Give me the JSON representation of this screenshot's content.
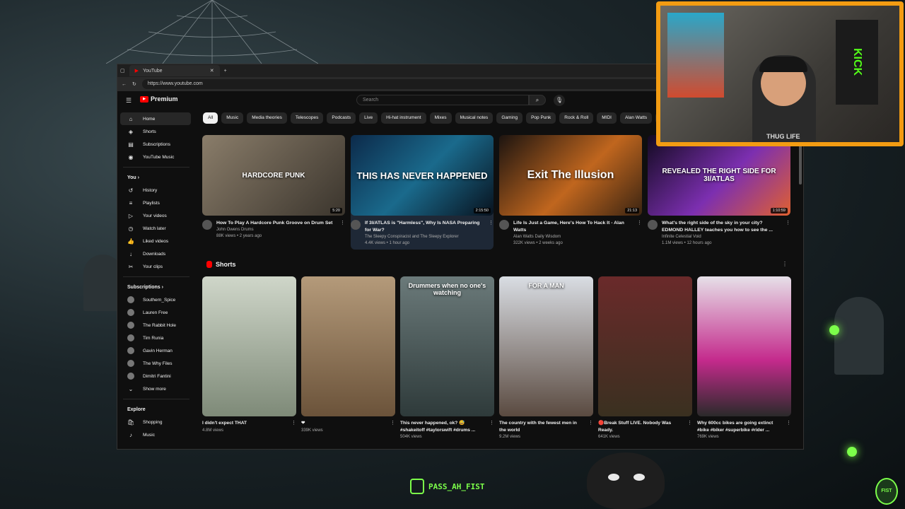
{
  "browser": {
    "tab_title": "YouTube",
    "url": "https://www.youtube.com"
  },
  "youtube": {
    "logo_text": "Premium",
    "search_placeholder": "Search",
    "chips": [
      "All",
      "Music",
      "Media theories",
      "Telescopes",
      "Podcasts",
      "Live",
      "Hi-hat instrument",
      "Mixes",
      "Musical notes",
      "Gaming",
      "Pop Punk",
      "Rock & Roll",
      "MIDI",
      "Alan Watts",
      "AI",
      "Gu"
    ],
    "sidebar": {
      "main": [
        {
          "label": "Home",
          "icon": "home-icon"
        },
        {
          "label": "Shorts",
          "icon": "shorts-icon"
        },
        {
          "label": "Subscriptions",
          "icon": "subscriptions-icon"
        },
        {
          "label": "YouTube Music",
          "icon": "music-icon"
        }
      ],
      "you_heading": "You",
      "you": [
        {
          "label": "History",
          "icon": "history-icon"
        },
        {
          "label": "Playlists",
          "icon": "playlists-icon"
        },
        {
          "label": "Your videos",
          "icon": "your-videos-icon"
        },
        {
          "label": "Watch later",
          "icon": "watch-later-icon"
        },
        {
          "label": "Liked videos",
          "icon": "like-icon"
        },
        {
          "label": "Downloads",
          "icon": "download-icon"
        },
        {
          "label": "Your clips",
          "icon": "clips-icon"
        }
      ],
      "subscriptions_heading": "Subscriptions",
      "subscriptions": [
        {
          "label": "Southern_Spice"
        },
        {
          "label": "Lauren Free"
        },
        {
          "label": "The Rabbit Hole"
        },
        {
          "label": "Tim Runia"
        },
        {
          "label": "Gavin Herman"
        },
        {
          "label": "The Why Files"
        },
        {
          "label": "Dimitri Fantini"
        }
      ],
      "show_more": "Show more",
      "explore_heading": "Explore",
      "explore": [
        {
          "label": "Shopping",
          "icon": "shopping-icon"
        },
        {
          "label": "Music",
          "icon": "music-note-icon"
        }
      ]
    },
    "videos": [
      {
        "thumb_text": "HARDCORE PUNK",
        "duration": "5:20",
        "title": "How To Play A Hardcore Punk Groove on Drum Set",
        "channel": "John Owens Drums",
        "stats": "88K views • 2 years ago"
      },
      {
        "thumb_text": "THIS HAS NEVER HAPPENED",
        "duration": "2:15:50",
        "title": "If 3I/ATLAS is \"Harmless\", Why Is NASA Preparing for War?",
        "channel": "The Sleepy Conspiracist and The Sleepy Explorer",
        "stats": "4.4K views • 1 hour ago"
      },
      {
        "thumb_text": "Exit The Illusion",
        "duration": "21:13",
        "title": "Life Is Just a Game, Here's How To Hack It - Alan Watts",
        "channel": "Alan Watts Daily Wisdom",
        "stats": "322K views • 2 weeks ago"
      },
      {
        "thumb_text": "REVEALED THE RIGHT SIDE FOR 3I/ATLAS",
        "duration": "1:10:59",
        "title": "What's the right side of the sky in your city? EDMOND HALLEY teaches you how to see the ...",
        "channel": "Infinite Celestial Void",
        "stats": "1.1M views • 12 hours ago"
      }
    ],
    "shorts_heading": "Shorts",
    "shorts": [
      {
        "thumb_text": "",
        "title": "I didn't expect THAT",
        "views": "4.8M views"
      },
      {
        "thumb_text": "",
        "title": "❤",
        "views": "339K views"
      },
      {
        "thumb_text": "Drummers when no one's watching",
        "title": "This never happened, ok? 😅 #shakeitoff #taylorswift #drums ...",
        "views": "504K views"
      },
      {
        "thumb_text": "FOR A MAN",
        "title": "The country with the fewest men in the world",
        "views": "9.2M views"
      },
      {
        "thumb_text": "",
        "title": "🔴Break Stuff LIVE. Nobody Was Ready.",
        "views": "641K views"
      },
      {
        "thumb_text": "",
        "title": "Why 600cc bikes are going extinct #bike #biker #superbike #rider ...",
        "views": "769K views"
      }
    ]
  },
  "overlay": {
    "cam_flag": "KICK",
    "shirt_text": "THUG LIFE",
    "handle": "PASS_AH_FIST",
    "corner_logo": "FIST"
  },
  "colors": {
    "accent": "#f39c12",
    "brand_red": "#ff0000",
    "neon_green": "#7cff4a"
  }
}
